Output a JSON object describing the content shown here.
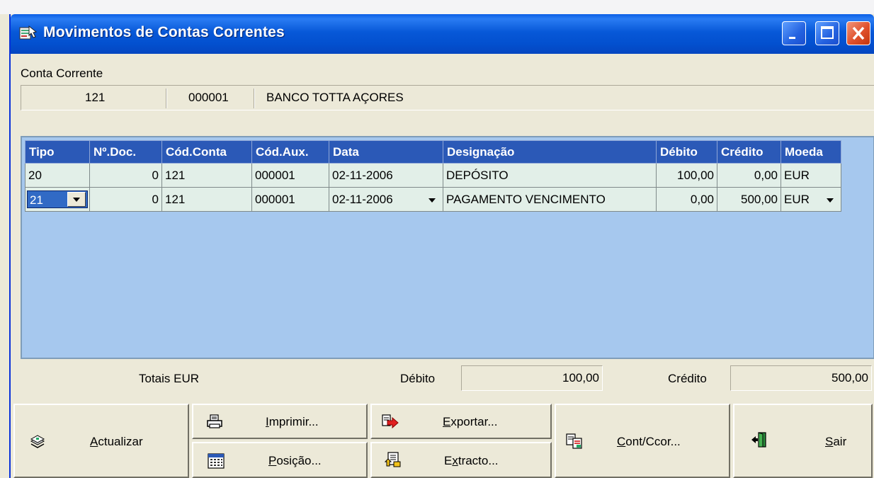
{
  "window": {
    "title": "Movimentos de Contas Correntes",
    "controls": [
      "minimize",
      "maximize",
      "close"
    ]
  },
  "account": {
    "label": "Conta Corrente",
    "code": "121",
    "aux": "000001",
    "name": "BANCO TOTTA AÇORES"
  },
  "grid": {
    "columns": [
      "Tipo",
      "Nº.Doc.",
      "Cód.Conta",
      "Cód.Aux.",
      "Data",
      "Designação",
      "Débito",
      "Crédito",
      "Moeda"
    ],
    "rows": [
      {
        "tipo": "20",
        "ndoc": "0",
        "conta": "121",
        "aux": "000001",
        "data": "02-11-2006",
        "designacao": "DEPÓSITO",
        "debito": "100,00",
        "credito": "0,00",
        "moeda": "EUR"
      },
      {
        "tipo": "21",
        "ndoc": "0",
        "conta": "121",
        "aux": "000001",
        "data": "02-11-2006",
        "designacao": "PAGAMENTO VENCIMENTO",
        "debito": "0,00",
        "credito": "500,00",
        "moeda": "EUR"
      }
    ]
  },
  "totals": {
    "label": "Totais EUR",
    "debito_label": "Débito",
    "debito_value": "100,00",
    "credito_label": "Crédito",
    "credito_value": "500,00"
  },
  "buttons": {
    "actualizar": {
      "mnemonic": "A",
      "rest": "ctualizar",
      "icon": "refresh-stack-icon"
    },
    "imprimir": {
      "mnemonic": "I",
      "rest": "mprimir...",
      "icon": "printer-icon"
    },
    "posicao": {
      "mnemonic": "P",
      "rest": "osição...",
      "icon": "calculator-icon"
    },
    "exportar": {
      "mnemonic": "E",
      "rest": "xportar...",
      "icon": "export-arrow-icon"
    },
    "extracto": {
      "pre": "E",
      "mnemonic": "x",
      "rest": "tracto...",
      "icon": "statement-icon"
    },
    "contccor": {
      "mnemonic": "C",
      "rest": "ont/Ccor...",
      "icon": "account-transfer-icon"
    },
    "sair": {
      "mnemonic": "S",
      "rest": "air",
      "icon": "exit-door-icon"
    }
  },
  "colors": {
    "title_bar": "#0758d8",
    "grid_header": "#2b59b7",
    "grid_background": "#a6c8ee",
    "row_background": "#e2efe8",
    "selection": "#316ac5",
    "face": "#ece9d8"
  }
}
